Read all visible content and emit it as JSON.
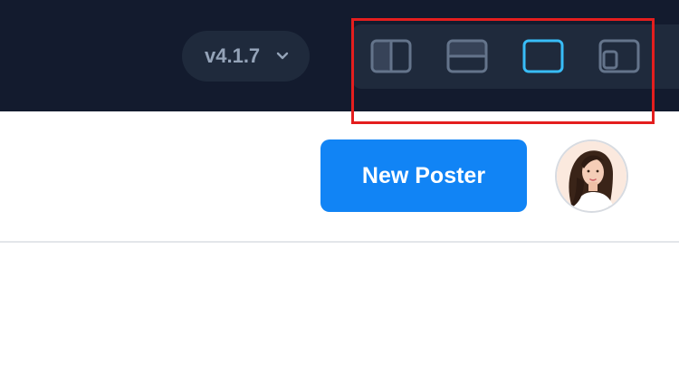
{
  "header": {
    "version_label": "v4.1.7",
    "version_icon": "chevron-down-icon",
    "layout_options": [
      {
        "name": "layout-split-vertical",
        "icon": "split-vertical-icon",
        "active": false
      },
      {
        "name": "layout-split-horizontal",
        "icon": "split-horizontal-icon",
        "active": false
      },
      {
        "name": "layout-single",
        "icon": "single-pane-icon",
        "active": true
      },
      {
        "name": "layout-floating",
        "icon": "floating-pane-icon",
        "active": false
      }
    ]
  },
  "toolbar": {
    "new_poster_label": "New Poster"
  },
  "user": {
    "avatar_icon": "user-avatar"
  },
  "colors": {
    "topbar_bg": "#131b2e",
    "pill_bg": "#1f2a3c",
    "icon_inactive": "#64748b",
    "icon_active": "#38bdf8",
    "accent": "#1184f5",
    "highlight": "#e41e1e"
  }
}
